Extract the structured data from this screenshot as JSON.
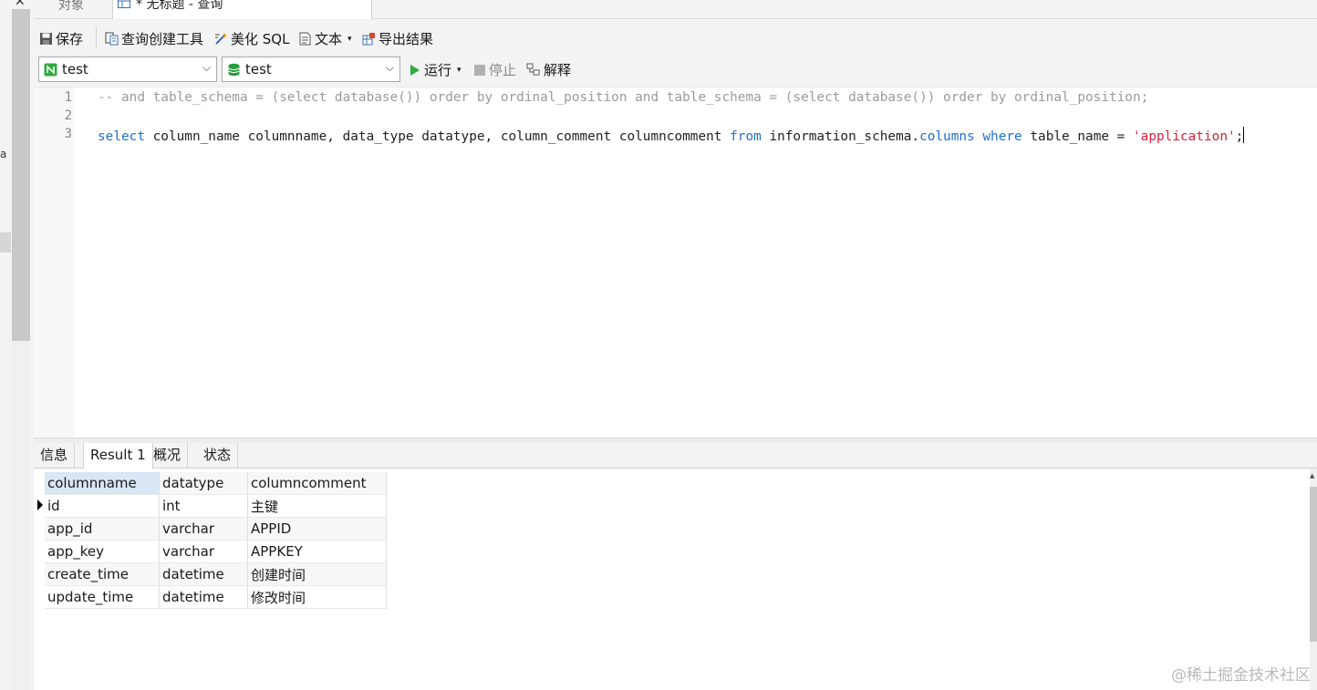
{
  "tabs": {
    "objects_label": "对象",
    "query_label": "* 无标题 - 查询"
  },
  "left": {
    "edge_text": "a"
  },
  "toolbar": {
    "save": "保存",
    "query_builder": "查询创建工具",
    "beautify": "美化 SQL",
    "text": "文本",
    "export": "导出结果"
  },
  "selectors": {
    "connection": "test",
    "database": "test",
    "run": "运行",
    "stop": "停止",
    "explain": "解释"
  },
  "editor": {
    "line_numbers": [
      "1",
      "2",
      "3"
    ],
    "line1": "-- and table_schema = (select database()) order by ordinal_position and table_schema = (select database()) order by ordinal_position;",
    "line3_parts": [
      "select",
      " column_name columnname, data_type datatype, column_comment columncomment ",
      "from",
      " information_schema.",
      "columns",
      " ",
      "where",
      " table_name = ",
      "'application'",
      ";"
    ]
  },
  "result_tabs": [
    "信息",
    "Result 1",
    "概况",
    "状态"
  ],
  "result": {
    "columns": [
      "columnname",
      "datatype",
      "columncomment"
    ],
    "rows": [
      [
        "id",
        "int",
        "主键"
      ],
      [
        "app_id",
        "varchar",
        "APPID"
      ],
      [
        "app_key",
        "varchar",
        "APPKEY"
      ],
      [
        "create_time",
        "datetime",
        "创建时间"
      ],
      [
        "update_time",
        "datetime",
        "修改时间"
      ]
    ]
  },
  "watermark": "@稀土掘金技术社区",
  "colors": {
    "keyword": "#1e6fd0",
    "string": "#d8203a",
    "comment": "#9a9a9a",
    "run_green": "#2eaa3c",
    "db_green": "#2a9d3a"
  },
  "icons": [
    "close-icon",
    "query-tab-icon",
    "save-icon",
    "query-builder-icon",
    "beautify-icon",
    "text-icon",
    "export-icon",
    "connection-icon",
    "database-icon",
    "run-icon",
    "stop-icon",
    "explain-icon",
    "row-pointer-icon"
  ]
}
